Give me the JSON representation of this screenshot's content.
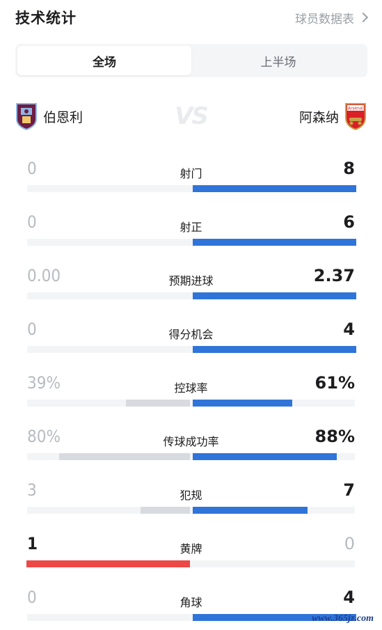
{
  "header": {
    "title": "技术统计",
    "link": "球员数据表"
  },
  "tabs": [
    {
      "label": "全场",
      "active": true
    },
    {
      "label": "上半场",
      "active": false
    }
  ],
  "teams": {
    "home": {
      "name": "伯恩利",
      "badge": "burnley-crest-icon"
    },
    "away": {
      "name": "阿森纳",
      "badge": "arsenal-crest-icon",
      "badge_text": "Arsenal"
    },
    "vs": "VS"
  },
  "stats": [
    {
      "label": "射门",
      "home": "0",
      "away": "8",
      "home_share": 0,
      "away_share": 1.0
    },
    {
      "label": "射正",
      "home": "0",
      "away": "6",
      "home_share": 0,
      "away_share": 1.0
    },
    {
      "label": "预期进球",
      "home": "0.00",
      "away": "2.37",
      "home_share": 0,
      "away_share": 1.0
    },
    {
      "label": "得分机会",
      "home": "0",
      "away": "4",
      "home_share": 0,
      "away_share": 1.0
    },
    {
      "label": "控球率",
      "home": "39%",
      "away": "61%",
      "home_share": 0.39,
      "away_share": 0.61
    },
    {
      "label": "传球成功率",
      "home": "80%",
      "away": "88%",
      "home_share": 0.8,
      "away_share": 0.88
    },
    {
      "label": "犯规",
      "home": "3",
      "away": "7",
      "home_share": 0.3,
      "away_share": 0.7
    },
    {
      "label": "黄牌",
      "home": "1",
      "away": "0",
      "home_share": 1.0,
      "away_share": 0
    },
    {
      "label": "角球",
      "home": "0",
      "away": "4",
      "home_share": 0,
      "away_share": 1.0
    }
  ],
  "colors": {
    "away_bar": "#2f74d9",
    "home_bar": "#d7dbe0",
    "home_win_bar": "#ec4846",
    "track": "#f3f4f6"
  },
  "watermark": "www.365jz.com"
}
